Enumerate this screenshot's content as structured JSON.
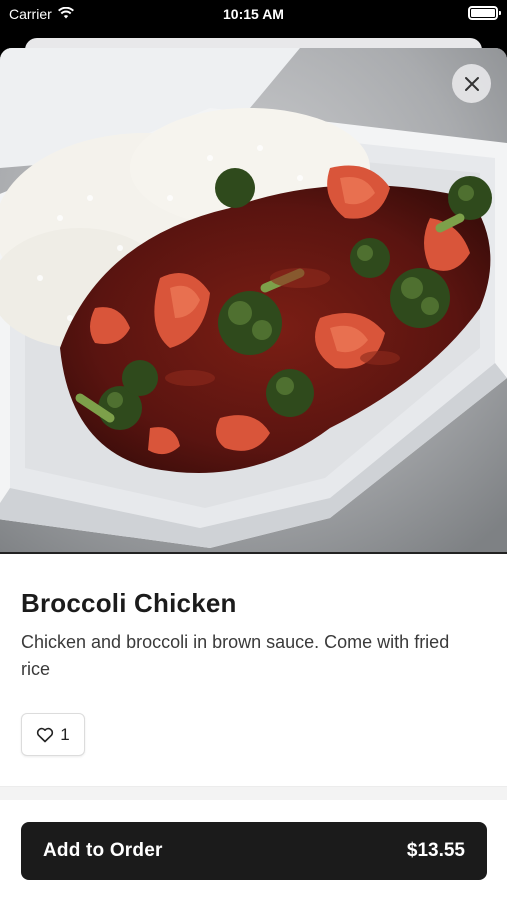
{
  "status_bar": {
    "carrier": "Carrier",
    "time": "10:15 AM",
    "icons": [
      "wifi-icon",
      "battery-icon"
    ]
  },
  "item": {
    "image_alt": "Broccoli chicken with rice in a foam container",
    "title": "Broccoli Chicken",
    "description": "Chicken and broccoli in brown sauce. Come with fried rice",
    "likes": "1"
  },
  "actions": {
    "close_icon": "close-icon",
    "like_icon": "heart-icon",
    "add_to_order_label": "Add to Order",
    "price": "$13.55"
  },
  "colors": {
    "button_bg": "#1b1b1b",
    "background": "#ffffff",
    "sauce": "#5b1410",
    "broccoli": "#2f4a1c"
  }
}
